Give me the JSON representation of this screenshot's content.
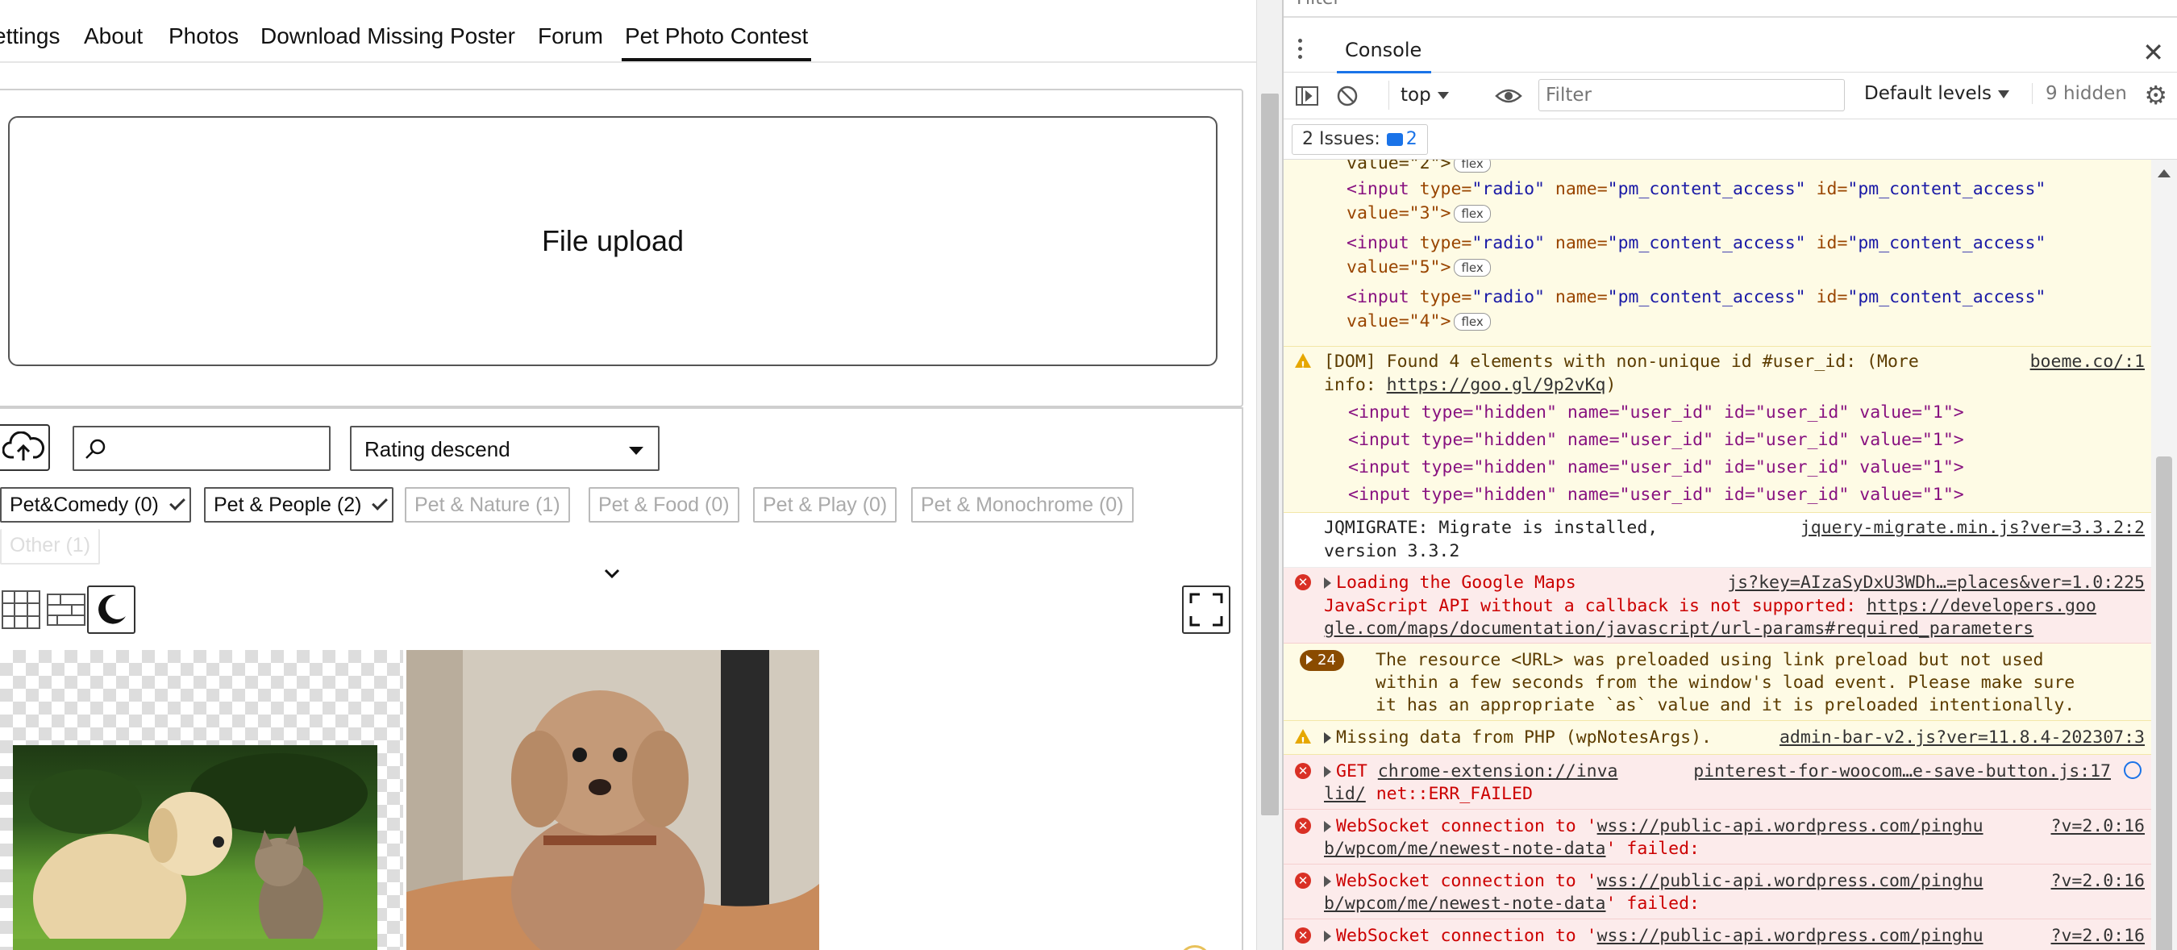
{
  "site": {
    "nav": [
      {
        "id": "settings",
        "label": "ettings"
      },
      {
        "id": "about",
        "label": "About"
      },
      {
        "id": "photos",
        "label": "Photos"
      },
      {
        "id": "download-missing-poster",
        "label": "Download Missing Poster"
      },
      {
        "id": "forum",
        "label": "Forum"
      },
      {
        "id": "pet-photo-contest",
        "label": "Pet Photo Contest",
        "active": true
      }
    ],
    "upload_label": "File upload",
    "search": {
      "value": "",
      "placeholder": ""
    },
    "sort": {
      "selected": "Rating descend"
    },
    "filters": [
      {
        "label": "Pet&Comedy",
        "count": "(0)",
        "checked": true
      },
      {
        "label": "Pet & People",
        "count": "(2)",
        "checked": true
      },
      {
        "label": "Pet & Nature",
        "count": "(1)",
        "checked": false
      },
      {
        "label": "Pet & Food",
        "count": "(0)",
        "checked": false
      },
      {
        "label": "Pet & Play",
        "count": "(0)",
        "checked": false
      },
      {
        "label": "Pet & Monochrome",
        "count": "(0)",
        "checked": false
      },
      {
        "label": "Other",
        "count": "(1)",
        "checked": false
      }
    ],
    "icons": {
      "upload": "cloud-upload-icon",
      "search": "search-icon",
      "grid_view": "grid-view-icon",
      "masonry_view": "masonry-view-icon",
      "dark_mode": "moon-icon",
      "fullscreen": "fullscreen-icon"
    }
  },
  "devtools": {
    "drawer_tab": "Console",
    "context": "top",
    "filter": {
      "value": "",
      "placeholder": "Filter"
    },
    "levels": "Default levels",
    "hidden": "9 hidden",
    "issues": {
      "label": "2 Issues:",
      "count": "2"
    },
    "radio_value_fragment": "value=\"2\">",
    "radio_inputs": [
      {
        "value": "value=\"3\">"
      },
      {
        "value": "value=\"5\">"
      },
      {
        "value": "value=\"4\">"
      }
    ],
    "radio_line": {
      "open": "<input",
      "type_attr": "type=",
      "type_val": "\"radio\"",
      "name_attr": "name=",
      "name_val": "\"pm_content_access\"",
      "id_attr": "id=",
      "id_val": "\"pm_content_access\""
    },
    "flex_badge": "flex",
    "dom_warning": {
      "line1": "[DOM] Found 4 elements with non-unique id #user_id: (More",
      "line2_prefix": "info: ",
      "link": "https://goo.gl/9p2vKq",
      "line2_suffix": ")",
      "source": "boeme.co/:1",
      "hidden_input": "<input type=\"hidden\" name=\"user_id\" id=\"user_id\" value=\"1\">"
    },
    "jqmigrate": {
      "line1": "JQMIGRATE: Migrate is installed,",
      "line2": "version 3.3.2",
      "source": "jquery-migrate.min.js?ver=3.3.2:2"
    },
    "maps_error": {
      "line1": "Loading the Google Maps",
      "line2_prefix": "JavaScript API without a callback is not supported: ",
      "link1": "https://developers.goo",
      "link2": "gle.com/maps/documentation/javascript/url-params#required_parameters",
      "source": "js?key=AIzaSyDxU3WDh…=places&ver=1.0:225"
    },
    "preload_warning": {
      "count": "24",
      "lines": [
        "The resource <URL> was preloaded using link preload but not used",
        "within a few seconds from the window's load event. Please make sure",
        "it has an appropriate `as` value and it is preloaded intentionally."
      ]
    },
    "php_warning": {
      "text": "Missing data from PHP (wpNotesArgs).",
      "source": "admin-bar-v2.js?ver=11.8.4-202307:3"
    },
    "get_error": {
      "prefix": "GET ",
      "link1": "chrome-extension://inva",
      "link2": "lid/",
      "suffix": " net::ERR_FAILED",
      "source": "pinterest-for-woocom…e-save-button.js:17"
    },
    "websocket_error": {
      "prefix": "WebSocket connection to '",
      "link1": "wss://public-api.wordpress.com/pinghu",
      "link2": "b/wpcom/me/newest-note-data",
      "suffix": "' failed:",
      "source": "?v=2.0:16"
    }
  }
}
